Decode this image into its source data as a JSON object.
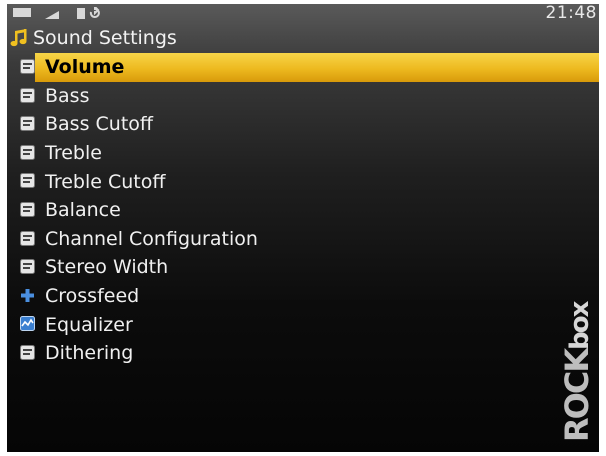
{
  "status": {
    "clock": "21:48"
  },
  "header": {
    "title": "Sound Settings",
    "icon": "music-note-icon"
  },
  "menu": {
    "items": [
      {
        "label": "Volume",
        "icon": "setting-icon",
        "selected": true
      },
      {
        "label": "Bass",
        "icon": "setting-icon"
      },
      {
        "label": "Bass Cutoff",
        "icon": "setting-icon"
      },
      {
        "label": "Treble",
        "icon": "setting-icon"
      },
      {
        "label": "Treble Cutoff",
        "icon": "setting-icon"
      },
      {
        "label": "Balance",
        "icon": "setting-icon"
      },
      {
        "label": "Channel Configuration",
        "icon": "setting-icon"
      },
      {
        "label": "Stereo Width",
        "icon": "setting-icon"
      },
      {
        "label": "Crossfeed",
        "icon": "plus-icon"
      },
      {
        "label": "Equalizer",
        "icon": "equalizer-icon"
      },
      {
        "label": "Dithering",
        "icon": "setting-icon"
      }
    ]
  },
  "logo": {
    "text": "ROCKbox"
  },
  "colors": {
    "selection": "#edb91f",
    "note": "#f0c020",
    "crossfeed": "#4a8fe0"
  }
}
